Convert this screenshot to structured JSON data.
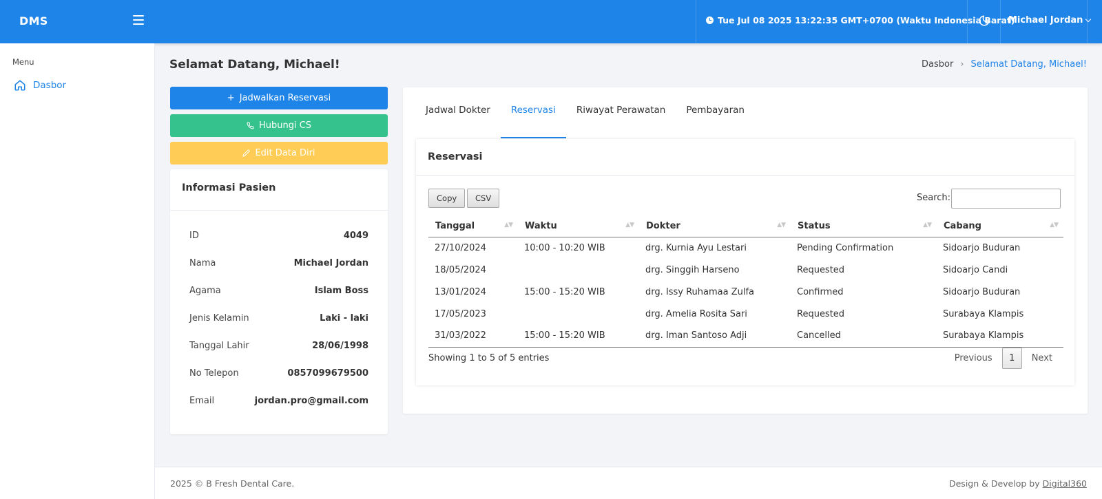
{
  "topbar": {
    "brand": "DMS",
    "datetime": "Tue Jul 08 2025 13:22:35 GMT+0700 (Waktu Indonesia Barat)",
    "user_name": "Michael Jordan"
  },
  "sidebar": {
    "menu_title": "Menu",
    "items": [
      {
        "label": "Dasbor"
      }
    ]
  },
  "page": {
    "title": "Selamat Datang, Michael!",
    "breadcrumb": [
      "Dasbor",
      "Selamat Datang, Michael!"
    ]
  },
  "actions": {
    "schedule": "Jadwalkan Reservasi",
    "contact": "Hubungi CS",
    "edit": "Edit Data Diri"
  },
  "patient": {
    "title": "Informasi Pasien",
    "rows": [
      {
        "label": "ID",
        "value": "4049"
      },
      {
        "label": "Nama",
        "value": "Michael Jordan"
      },
      {
        "label": "Agama",
        "value": "Islam Boss"
      },
      {
        "label": "Jenis Kelamin",
        "value": "Laki - laki"
      },
      {
        "label": "Tanggal Lahir",
        "value": "28/06/1998"
      },
      {
        "label": "No Telepon",
        "value": "0857099679500"
      },
      {
        "label": "Email",
        "value": "jordan.pro@gmail.com"
      }
    ]
  },
  "tabs": [
    {
      "label": "Jadwal Dokter"
    },
    {
      "label": "Reservasi",
      "active": true
    },
    {
      "label": "Riwayat Perawatan"
    },
    {
      "label": "Pembayaran"
    }
  ],
  "reservations": {
    "title": "Reservasi",
    "copy_label": "Copy",
    "csv_label": "CSV",
    "search_label": "Search:",
    "search_value": "",
    "columns": [
      "Tanggal",
      "Waktu",
      "Dokter",
      "Status",
      "Cabang"
    ],
    "rows": [
      [
        "27/10/2024",
        "10:00 - 10:20 WIB",
        "drg. Kurnia Ayu Lestari",
        "Pending Confirmation",
        "Sidoarjo Buduran"
      ],
      [
        "18/05/2024",
        "",
        "drg. Singgih Harseno",
        "Requested",
        "Sidoarjo Candi"
      ],
      [
        "13/01/2024",
        "15:00 - 15:20 WIB",
        "drg. Issy Ruhamaa Zulfa",
        "Confirmed",
        "Sidoarjo Buduran"
      ],
      [
        "17/05/2023",
        "",
        "drg. Amelia Rosita Sari",
        "Requested",
        "Surabaya Klampis"
      ],
      [
        "31/03/2022",
        "15:00 - 15:20 WIB",
        "drg. Iman Santoso Adji",
        "Cancelled",
        "Surabaya Klampis"
      ]
    ],
    "info": "Showing 1 to 5 of 5 entries",
    "prev_label": "Previous",
    "current_page": "1",
    "next_label": "Next"
  },
  "footer": {
    "copyright": "2025 © B Fresh Dental Care.",
    "credit_prefix": "Design & Develop by",
    "credit_link": "Digital360"
  },
  "colors": {
    "primary": "#1e84e8",
    "success": "#35c28d",
    "warning": "#ffcc55"
  },
  "icons": {
    "clock": "clock-icon",
    "moon": "moon-icon",
    "home": "home-icon",
    "plus": "plus-icon",
    "phone": "phone-icon",
    "pencil": "pencil-icon"
  }
}
